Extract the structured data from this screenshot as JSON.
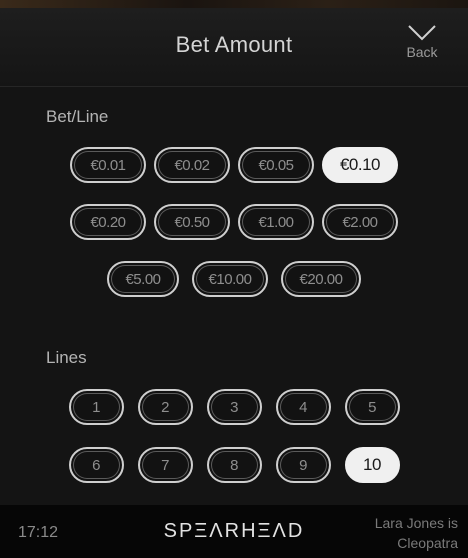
{
  "header": {
    "title": "Bet Amount",
    "back_label": "Back"
  },
  "bet_per_line": {
    "label": "Bet/Line",
    "rows": [
      [
        "€0.01",
        "€0.02",
        "€0.05",
        "€0.10"
      ],
      [
        "€0.20",
        "€0.50",
        "€1.00",
        "€2.00"
      ],
      [
        "€5.00",
        "€10.00",
        "€20.00"
      ]
    ],
    "selected": "€0.10"
  },
  "lines": {
    "label": "Lines",
    "rows": [
      [
        "1",
        "2",
        "3",
        "4",
        "5"
      ],
      [
        "6",
        "7",
        "8",
        "9",
        "10"
      ]
    ],
    "selected": "10"
  },
  "footer": {
    "time": "17:12",
    "brand": "SPΞΛRHΞΛD",
    "game_line1": "Lara Jones is",
    "game_line2": "Cleopatra"
  },
  "icons": {
    "back": "chevron-down-icon"
  },
  "colors": {
    "background": "#141414",
    "pill_border": "#cfcfcf",
    "pill_text": "#8e8e8e",
    "selected_fill": "#f0f0f0",
    "selected_text": "#1a1a1a"
  }
}
